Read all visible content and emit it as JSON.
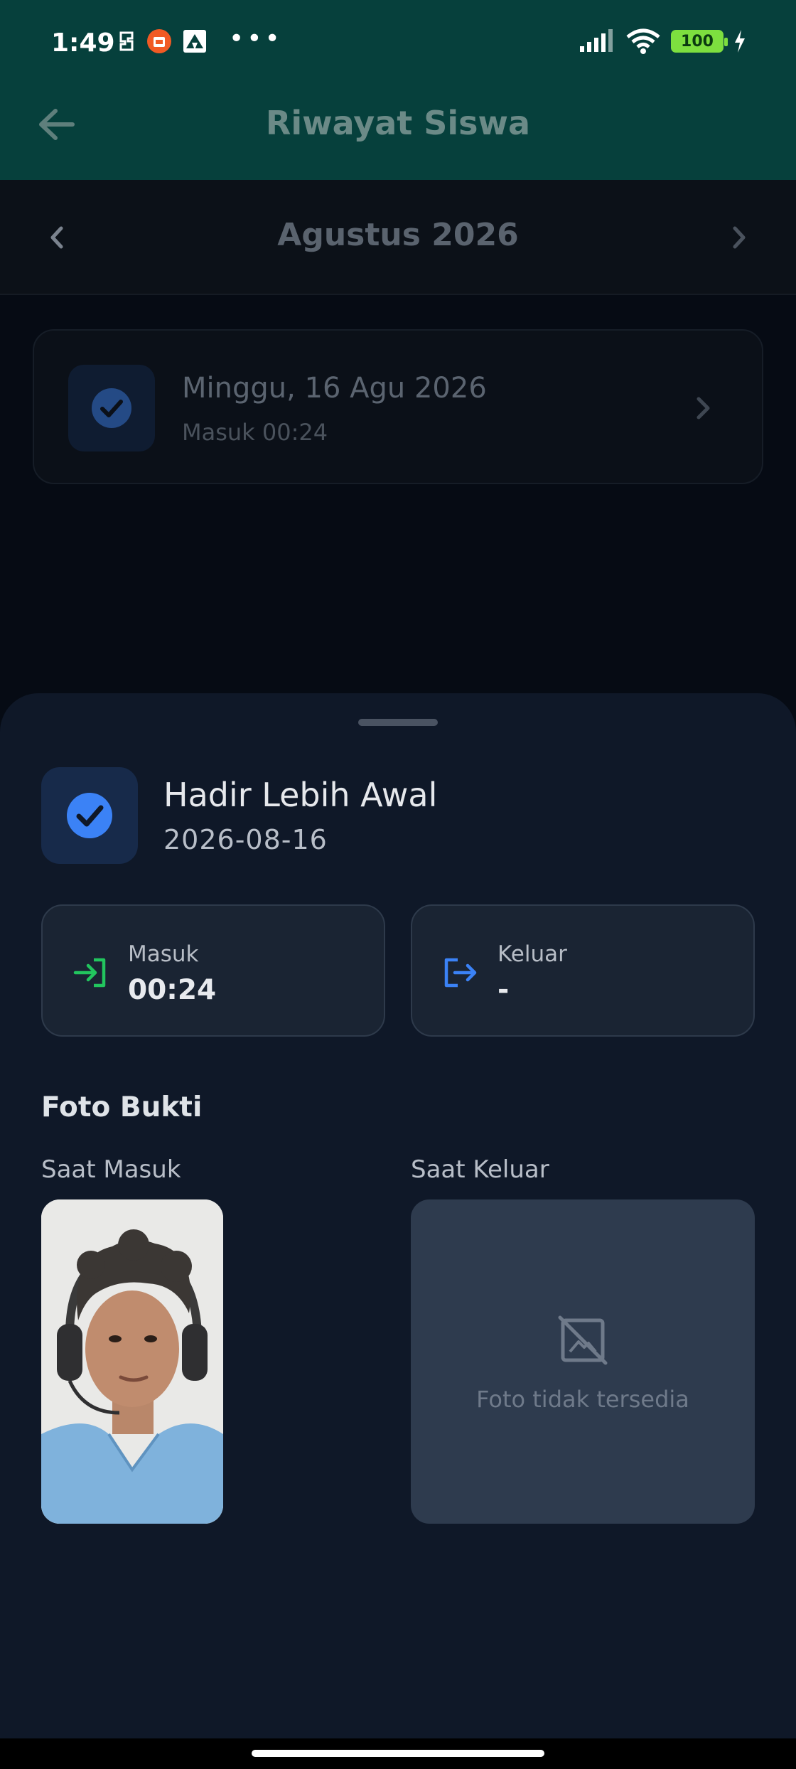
{
  "status_bar": {
    "time": "1:49",
    "battery": "100"
  },
  "app_bar": {
    "title": "Riwayat Siswa"
  },
  "month_nav": {
    "label": "Agustus 2026"
  },
  "history_list": [
    {
      "date": "Minggu, 16 Agu 2026",
      "time": "Masuk 00:24"
    }
  ],
  "detail_sheet": {
    "status_title": "Hadir Lebih Awal",
    "status_date": "2026-08-16",
    "check_in": {
      "label": "Masuk",
      "value": "00:24"
    },
    "check_out": {
      "label": "Keluar",
      "value": "-"
    },
    "photos_title": "Foto Bukti",
    "photo_in_label": "Saat Masuk",
    "photo_out_label": "Saat Keluar",
    "photo_out_placeholder": "Foto tidak tersedia"
  },
  "colors": {
    "app_bar": "#06403c",
    "sheet": "#0f1828",
    "accent_blue": "#3b82f6",
    "check_in_green": "#22c55e"
  }
}
